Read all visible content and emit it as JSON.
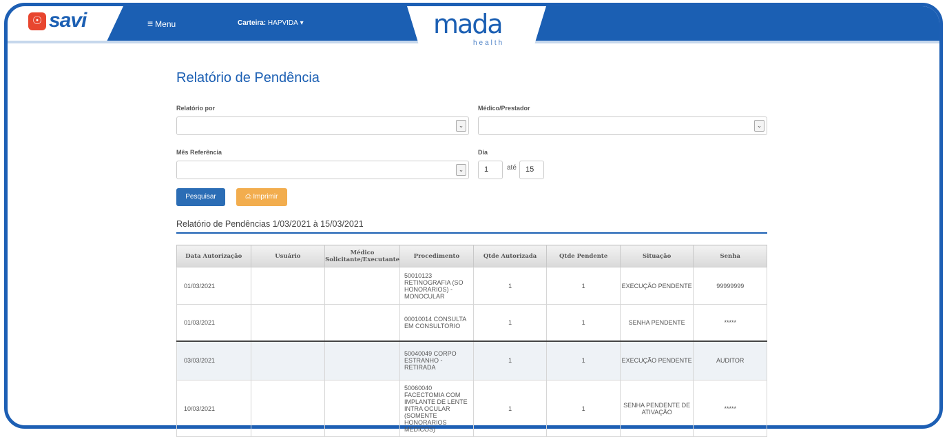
{
  "header": {
    "logo_text": "savi",
    "logo_icon": "fingerprint-icon",
    "menu_label": "Menu",
    "carteira_label": "Carteira:",
    "carteira_value": "HAPVIDA",
    "brand_name": "mada",
    "brand_sub": "health"
  },
  "page": {
    "title": "Relatório de Pendência"
  },
  "form": {
    "relatorio_por_label": "Relatório por",
    "relatorio_por_value": "",
    "medico_prestador_label": "Médico/Prestador",
    "medico_prestador_value": "",
    "mes_referencia_label": "Mês Referência",
    "mes_referencia_value": "",
    "dia_label": "Dia",
    "dia_de": "1",
    "ate_label": "até",
    "dia_ate": "15",
    "pesquisar_label": "Pesquisar",
    "imprimir_label": "Imprimir"
  },
  "report": {
    "subtitle": "Relatório de Pendências 1/03/2021 à 15/03/2021",
    "columns": [
      "Data Autorização",
      "Usuário",
      "Médico Solicitante/Executante",
      "Procedimento",
      "Qtde Autorizada",
      "Qtde Pendente",
      "Situação",
      "Senha"
    ],
    "rows": [
      {
        "data": "01/03/2021",
        "usuario": "",
        "medico": "",
        "procedimento": "50010123 RETINOGRAFIA (SO HONORARIOS) - MONOCULAR",
        "qtde_autorizada": "1",
        "qtde_pendente": "1",
        "situacao": "EXECUÇÃO PENDENTE",
        "senha": "99999999"
      },
      {
        "data": "01/03/2021",
        "usuario": "",
        "medico": "",
        "procedimento": "00010014 CONSULTA EM CONSULTORIO",
        "qtde_autorizada": "1",
        "qtde_pendente": "1",
        "situacao": "SENHA PENDENTE",
        "senha": "*****"
      },
      {
        "data": "03/03/2021",
        "usuario": "",
        "medico": "",
        "procedimento": "50040049 CORPO ESTRANHO - RETIRADA",
        "qtde_autorizada": "1",
        "qtde_pendente": "1",
        "situacao": "EXECUÇÃO PENDENTE",
        "senha": "AUDITOR"
      },
      {
        "data": "10/03/2021",
        "usuario": "",
        "medico": "",
        "procedimento": "50060040 FACECTOMIA COM IMPLANTE DE LENTE INTRA OCULAR (SOMENTE HONORARIOS MEDICOS)",
        "qtde_autorizada": "1",
        "qtde_pendente": "1",
        "situacao": "SENHA PENDENTE DE ATIVAÇÃO",
        "senha": "*****"
      }
    ]
  },
  "colors": {
    "brand_blue": "#1b5fb3",
    "accent_orange": "#f2ad4e",
    "logo_red": "#e8462f"
  }
}
